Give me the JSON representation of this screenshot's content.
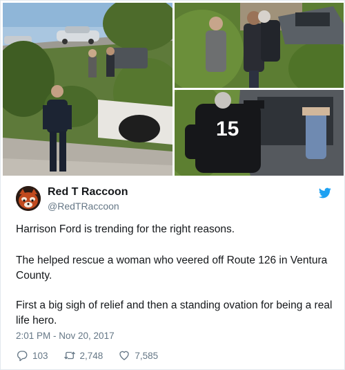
{
  "media": {
    "photos": [
      {
        "icon": "photo-rescue-scene"
      },
      {
        "icon": "photo-men-near-car"
      },
      {
        "icon": "photo-man-jersey-car"
      }
    ],
    "jersey_number": "15"
  },
  "user": {
    "display_name": "Red T Raccoon",
    "handle": "@RedTRaccoon",
    "avatar_icon": "red-panda-avatar"
  },
  "tweet": {
    "paragraphs": [
      "Harrison Ford is trending for the right reasons.",
      "The helped rescue a woman who veered off Route 126 in Ventura County.",
      "First a big sigh of relief and then a standing ovation for being a real life hero."
    ],
    "timestamp": "2:01 PM - Nov 20, 2017"
  },
  "stats": {
    "replies": "103",
    "retweets": "2,748",
    "likes": "7,585"
  },
  "colors": {
    "twitter_blue": "#1da1f2",
    "secondary_text": "#657786",
    "primary_text": "#14171a"
  }
}
